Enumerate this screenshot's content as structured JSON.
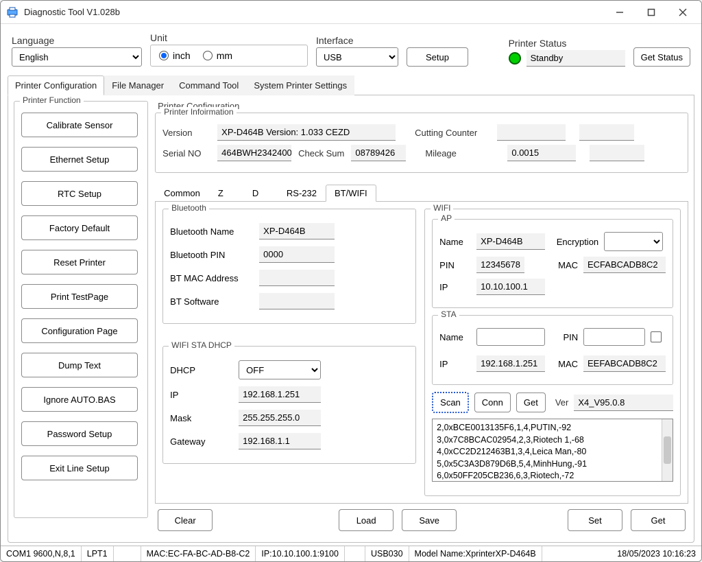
{
  "window": {
    "title": "Diagnostic Tool V1.028b"
  },
  "top": {
    "language_label": "Language",
    "language_value": "English",
    "unit_label": "Unit",
    "unit_inch": "inch",
    "unit_mm": "mm",
    "interface_label": "Interface",
    "interface_value": "USB",
    "setup_btn": "Setup",
    "printer_status_label": "Printer  Status",
    "printer_status_value": "Standby",
    "get_status_btn": "Get Status"
  },
  "maintabs": [
    "Printer Configuration",
    "File Manager",
    "Command Tool",
    "System Printer Settings"
  ],
  "pf_legend": "Printer  Function",
  "pf_buttons": [
    "Calibrate Sensor",
    "Ethernet Setup",
    "RTC Setup",
    "Factory Default",
    "Reset Printer",
    "Print TestPage",
    "Configuration Page",
    "Dump Text",
    "Ignore AUTO.BAS",
    "Password Setup",
    "Exit Line Setup"
  ],
  "cfg_legend": "Printer Configuration",
  "pinfo": {
    "legend": "Printer Infoirmation",
    "version_label": "Version",
    "version_value": "XP-D464B Version: 1.033 CEZD",
    "serial_label": "Serial NO",
    "serial_value": "464BWH2342400",
    "checksum_label": "Check Sum",
    "checksum_value": "08789426",
    "cutcnt_label": "Cutting Counter",
    "cutcnt_value": "",
    "mileage_label": "Mileage",
    "mileage_value": "0.0015"
  },
  "subtabs": [
    "Common",
    "Z",
    "D",
    "RS-232",
    "BT/WIFI"
  ],
  "bt": {
    "legend": "Bluetooth",
    "name_label": "Bluetooth Name",
    "name_value": "XP-D464B",
    "pin_label": "Bluetooth PIN",
    "pin_value": "0000",
    "mac_label": "BT MAC Address",
    "mac_value": "",
    "sw_label": "BT Software",
    "sw_value": ""
  },
  "dhcp": {
    "legend": "WIFI STA DHCP",
    "dhcp_label": "DHCP",
    "dhcp_value": "OFF",
    "ip_label": "IP",
    "ip_value": "192.168.1.251",
    "mask_label": "Mask",
    "mask_value": "255.255.255.0",
    "gw_label": "Gateway",
    "gw_value": "192.168.1.1"
  },
  "wifi": {
    "legend": "WIFI",
    "ap_legend": "AP",
    "ap_name_label": "Name",
    "ap_name_value": "XP-D464B",
    "ap_pin_label": "PIN",
    "ap_pin_value": "12345678",
    "ap_ip_label": "IP",
    "ap_ip_value": "10.10.100.1",
    "enc_label": "Encryption",
    "mac_label": "MAC",
    "ap_mac_value": "ECFABCADB8C2",
    "sta_legend": "STA",
    "sta_name_label": "Name",
    "sta_name_value": "",
    "sta_pin_label": "PIN",
    "sta_pin_value": "",
    "sta_ip_label": "IP",
    "sta_ip_value": "192.168.1.251",
    "sta_mac_value": "EEFABCADB8C2",
    "scan_btn": "Scan",
    "conn_btn": "Conn",
    "get_btn": "Get",
    "ver_label": "Ver",
    "ver_value": "X4_V95.0.8",
    "scan_results": "2,0xBCE0013135F6,1,4,PUTIN,-92\n3,0x7C8BCAC02954,2,3,Riotech 1,-68\n4,0xCC2D212463B1,3,4,Leica Man,-80\n5,0x5C3A3D879D6B,5,4,MinhHung,-91\n6,0x50FF205CB236,6,3,Riotech,-72"
  },
  "bottom": {
    "clear": "Clear",
    "load": "Load",
    "save": "Save",
    "set": "Set",
    "get": "Get"
  },
  "status": {
    "com": "COM1 9600,N,8,1",
    "lpt": "LPT1",
    "mac": "MAC:EC-FA-BC-AD-B8-C2",
    "ip": "IP:10.10.100.1:9100",
    "usb": "USB030",
    "model": "Model Name:XprinterXP-D464B",
    "time": "18/05/2023 10:16:23"
  }
}
